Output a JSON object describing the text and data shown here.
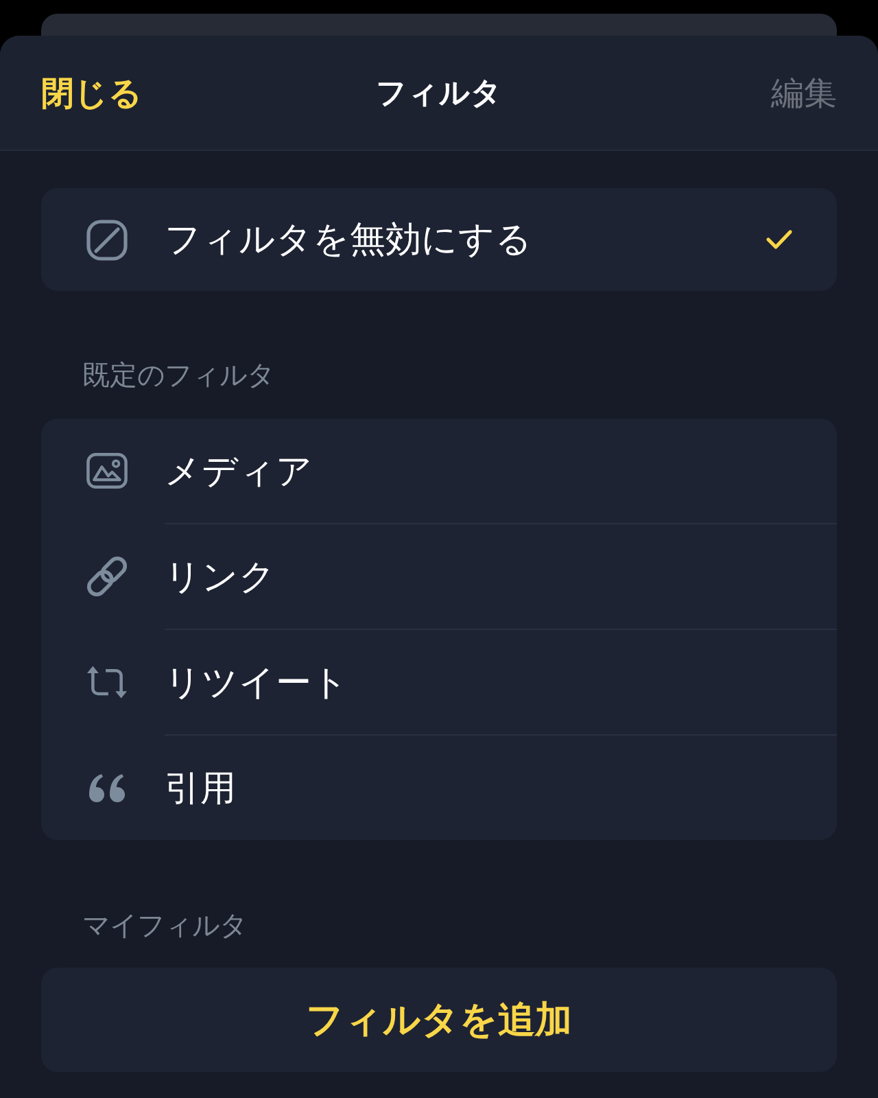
{
  "header": {
    "close_label": "閉じる",
    "title": "フィルタ",
    "edit": {
      "label": "編集",
      "disabled": true
    }
  },
  "disable_filter": {
    "label": "フィルタを無効にする",
    "selected": true
  },
  "default_filters": {
    "heading": "既定のフィルタ",
    "items": [
      {
        "kind": "media",
        "label": "メディア",
        "selected": false
      },
      {
        "kind": "link",
        "label": "リンク",
        "selected": false
      },
      {
        "kind": "retweet",
        "label": "リツイート",
        "selected": false
      },
      {
        "kind": "quote",
        "label": "引用",
        "selected": false
      }
    ]
  },
  "my_filters": {
    "heading": "マイフィルタ",
    "add_button": "フィルタを追加"
  }
}
